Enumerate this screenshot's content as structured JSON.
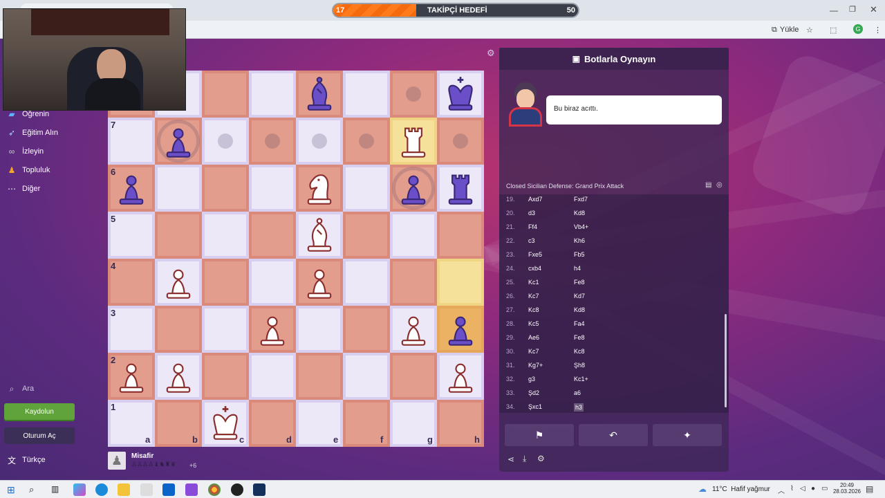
{
  "browser": {
    "upload_label": "Yükle",
    "profile_initial": "G"
  },
  "overlay": {
    "goal_label": "TAKİPÇİ HEDEFİ",
    "goal_current": "17",
    "goal_target": "50",
    "goal_progress": 0.34
  },
  "nav": {
    "items": [
      {
        "label": "Öğrenin",
        "icon": "graduation-icon"
      },
      {
        "label": "Eğitim Alın",
        "icon": "target-icon"
      },
      {
        "label": "İzleyin",
        "icon": "binoculars-icon"
      },
      {
        "label": "Topluluk",
        "icon": "community-icon"
      },
      {
        "label": "Diğer",
        "icon": "more-icon"
      }
    ],
    "search_label": "Ara",
    "signup_label": "Kaydolun",
    "login_label": "Oturum Aç",
    "language_label": "Türkçe"
  },
  "board": {
    "ranks": [
      "7",
      "6",
      "5",
      "4",
      "3",
      "2",
      "1"
    ],
    "files": [
      "a",
      "b",
      "c",
      "d",
      "e",
      "f",
      "g",
      "h"
    ],
    "pieces": [
      {
        "sq": "e8",
        "type": "bishop",
        "color": "black"
      },
      {
        "sq": "h8",
        "type": "king",
        "color": "black"
      },
      {
        "sq": "b7",
        "type": "pawn",
        "color": "black"
      },
      {
        "sq": "g7",
        "type": "rook",
        "color": "white"
      },
      {
        "sq": "a6",
        "type": "pawn",
        "color": "black"
      },
      {
        "sq": "e6",
        "type": "knight",
        "color": "white"
      },
      {
        "sq": "g6",
        "type": "pawn",
        "color": "black"
      },
      {
        "sq": "h6",
        "type": "rook",
        "color": "black"
      },
      {
        "sq": "e5",
        "type": "bishop",
        "color": "white"
      },
      {
        "sq": "b4",
        "type": "pawn",
        "color": "white"
      },
      {
        "sq": "e4",
        "type": "pawn",
        "color": "white"
      },
      {
        "sq": "d3",
        "type": "pawn",
        "color": "white"
      },
      {
        "sq": "g3",
        "type": "pawn",
        "color": "white"
      },
      {
        "sq": "h3",
        "type": "pawn",
        "color": "black"
      },
      {
        "sq": "a2",
        "type": "pawn",
        "color": "white"
      },
      {
        "sq": "b2",
        "type": "pawn",
        "color": "white"
      },
      {
        "sq": "h2",
        "type": "pawn",
        "color": "white"
      },
      {
        "sq": "c1",
        "type": "king",
        "color": "white"
      }
    ],
    "highlight_squares": [
      "g7",
      "h4",
      "h3"
    ],
    "move_dots": [
      "g8",
      "c7",
      "d7",
      "e7",
      "f7",
      "h7"
    ],
    "capture_rings": [
      "b7",
      "g6"
    ]
  },
  "player": {
    "name": "Misafir",
    "captured": "♙♙♙♙♝♞♜♛",
    "advantage": "+6"
  },
  "panel": {
    "title": "Botlarla Oynayın",
    "bot_message": "Bu biraz acıttı.",
    "opening": "Closed Sicilian Defense: Grand Prix Attack",
    "moves": [
      {
        "n": "19.",
        "w": "Axd7",
        "b": "Fxd7"
      },
      {
        "n": "20.",
        "w": "d3",
        "b": "Kd8"
      },
      {
        "n": "21.",
        "w": "Ff4",
        "b": "Vb4+"
      },
      {
        "n": "22.",
        "w": "c3",
        "b": "Kh6"
      },
      {
        "n": "23.",
        "w": "Fxe5",
        "b": "Fb5"
      },
      {
        "n": "24.",
        "w": "cxb4",
        "b": "h4"
      },
      {
        "n": "25.",
        "w": "Kc1",
        "b": "Fe8"
      },
      {
        "n": "26.",
        "w": "Kc7",
        "b": "Kd7"
      },
      {
        "n": "27.",
        "w": "Kc8",
        "b": "Kd8"
      },
      {
        "n": "28.",
        "w": "Kc5",
        "b": "Fa4"
      },
      {
        "n": "29.",
        "w": "Ae6",
        "b": "Fe8"
      },
      {
        "n": "30.",
        "w": "Kc7",
        "b": "Kc8"
      },
      {
        "n": "31.",
        "w": "Kg7+",
        "b": "Şh8"
      },
      {
        "n": "32.",
        "w": "g3",
        "b": "Kc1+"
      },
      {
        "n": "33.",
        "w": "Şd2",
        "b": "a6"
      },
      {
        "n": "34.",
        "w": "Şxc1",
        "b": "h3"
      }
    ]
  },
  "taskbar": {
    "weather": "11°C  Hafif yağmur",
    "time": "20:49",
    "date": "28.03.2026"
  },
  "colors": {
    "light_square": "#ece8f8",
    "dark_square": "#e39d8c",
    "black_piece": "#6b4fc9",
    "white_piece": "#ffffff",
    "accent_green": "#5fa33a"
  }
}
